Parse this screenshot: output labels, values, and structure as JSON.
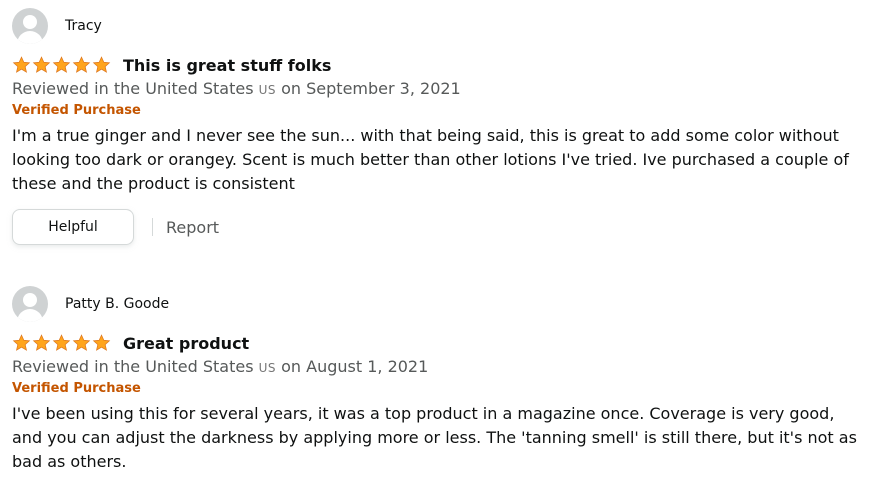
{
  "colors": {
    "star": "#ffa41c",
    "verified": "#c45500",
    "meta": "#565959"
  },
  "reviews": [
    {
      "name": "Tracy",
      "rating": 5,
      "title": "This is great stuff folks",
      "meta_prefix": "Reviewed in the United States",
      "country_code": "US",
      "meta_date": "on September 3, 2021",
      "verified": "Verified Purchase",
      "body": "I'm a true ginger and I never see the sun... with that being said, this is great to add some color without looking too dark or orangey. Scent is much better than other lotions I've tried. Ive purchased a couple of these and the product is consistent",
      "helpful_label": "Helpful",
      "report_label": "Report"
    },
    {
      "name": "Patty B. Goode",
      "rating": 5,
      "title": "Great product",
      "meta_prefix": "Reviewed in the United States",
      "country_code": "US",
      "meta_date": "on August 1, 2021",
      "verified": "Verified Purchase",
      "body": "I've been using this for several years, it was a top product in a magazine once. Coverage is very good, and you can adjust the darkness by applying more or less. The 'tanning smell' is still there, but it's not as bad as others."
    }
  ]
}
